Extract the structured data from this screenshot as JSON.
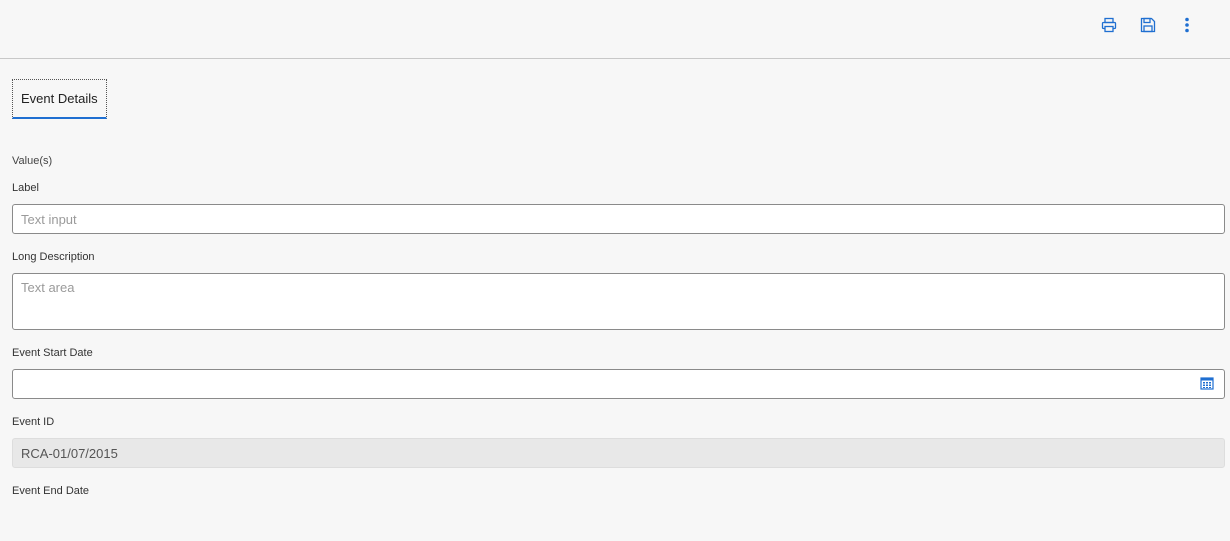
{
  "toolbar": {
    "icons": [
      "print-icon",
      "save-icon",
      "more-vertical-icon"
    ],
    "accent": "#1f6fd1"
  },
  "tabs": [
    {
      "label": "Event Details",
      "active": true
    }
  ],
  "form": {
    "section_label": "Value(s)",
    "label_field": {
      "label": "Label",
      "value": "",
      "placeholder": "Text input"
    },
    "long_description": {
      "label": "Long Description",
      "value": "",
      "placeholder": "Text area"
    },
    "event_start_date": {
      "label": "Event Start Date",
      "value": ""
    },
    "event_id": {
      "label": "Event ID",
      "value": "RCA-01/07/2015"
    },
    "event_end_date": {
      "label": "Event End Date"
    }
  }
}
